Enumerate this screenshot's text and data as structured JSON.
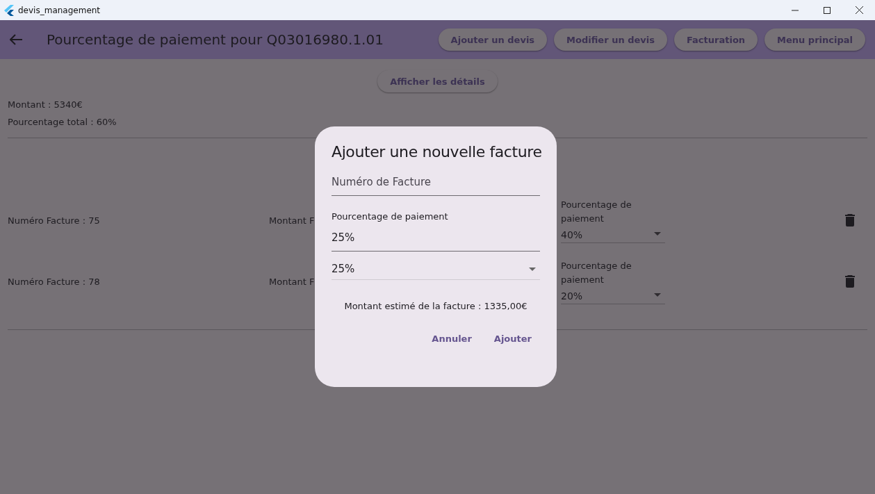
{
  "window": {
    "title": "devis_management"
  },
  "app_bar": {
    "title": "Pourcentage de paiement pour Q03016980.1.01",
    "actions": [
      "Ajouter un devis",
      "Modifier un devis",
      "Facturation",
      "Menu principal"
    ]
  },
  "details_button": "Afficher les détails",
  "summary": [
    "Montant : 5340€",
    "Pourcentage total : 60%"
  ],
  "invoices": [
    {
      "number": "Numéro Facture : 75",
      "amount": "Montant F",
      "percent_label": "Pourcentage de paiement",
      "percent": "40%"
    },
    {
      "number": "Numéro Facture : 78",
      "amount": "Montant F",
      "percent_label": "Pourcentage de paiement",
      "percent": "20%"
    }
  ],
  "dialog": {
    "title": "Ajouter une nouvelle facture",
    "invoice_field": {
      "placeholder": "Numéro de Facture"
    },
    "percent_field": {
      "label": "Pourcentage de paiement",
      "value": "25%"
    },
    "percent_dropdown": "25%",
    "estimate": "Montant estimé de la facture : 1335,00€",
    "buttons": [
      "Annuler",
      "Ajouter"
    ]
  }
}
